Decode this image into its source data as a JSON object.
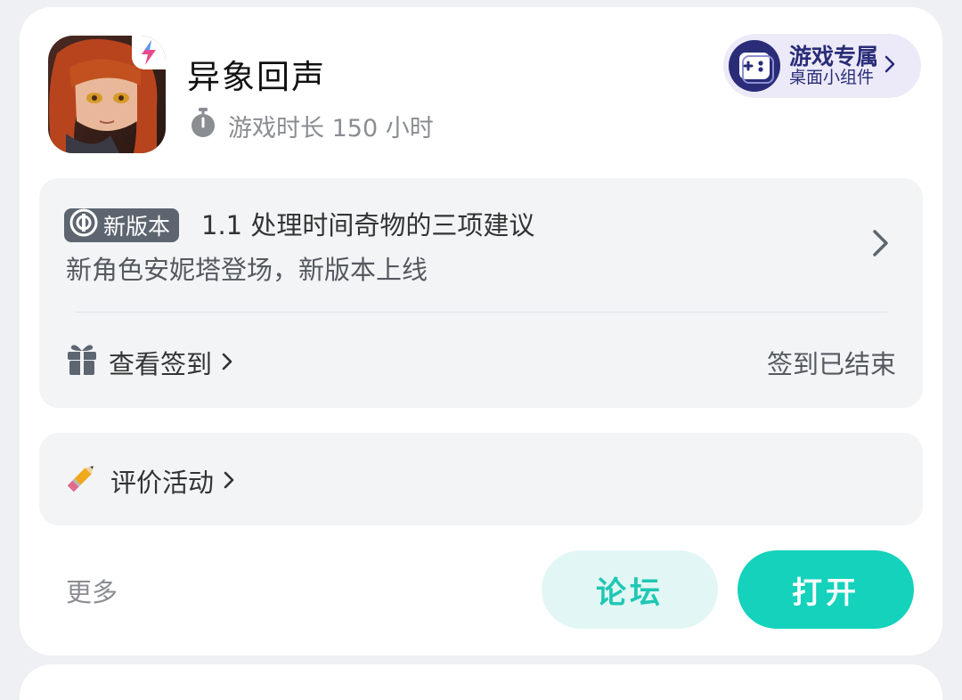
{
  "game": {
    "title": "异象回声",
    "playtime": "游戏时长 150 小时",
    "icon": "game-portrait-icon"
  },
  "widget": {
    "title": "游戏专属",
    "subtitle": "桌面小组件"
  },
  "update": {
    "badge": "新版本",
    "title": "1.1 处理时间奇物的三项建议",
    "subtitle": "新角色安妮塔登场，新版本上线"
  },
  "checkin": {
    "label": "查看签到",
    "status": "签到已结束"
  },
  "review": {
    "label": "评价活动"
  },
  "footer": {
    "more": "更多",
    "forum": "论坛",
    "open": "打开"
  },
  "colors": {
    "accent": "#14d2bb",
    "accent_light": "#e2f7f5",
    "widget_bg": "#eceaf8",
    "widget_text": "#2a2c78",
    "panel_bg": "#f2f4f6"
  }
}
